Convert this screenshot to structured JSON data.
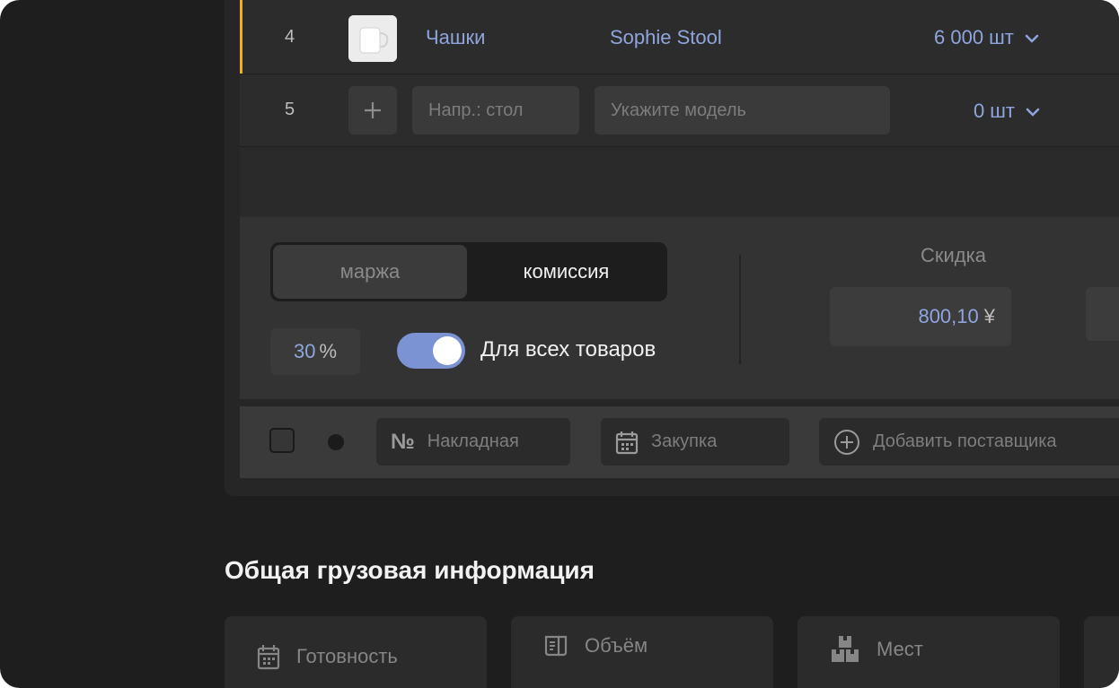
{
  "rows": [
    {
      "num": "4",
      "name": "Чашки",
      "model": "Sophie Stool",
      "qty": "6 000",
      "unit": "шт"
    },
    {
      "num": "5",
      "name_placeholder": "Напр.: стол",
      "model_placeholder": "Укажите модель",
      "qty": "0",
      "unit": "шт"
    }
  ],
  "pricing": {
    "mode_options": [
      "маржа",
      "комиссия"
    ],
    "selected_mode": "комиссия",
    "percent_value": "30",
    "percent_unit": "%",
    "toggle_label": "Для всех товаров",
    "toggle_on": true,
    "discount_label": "Скидка",
    "discount_value": "800,10",
    "discount_currency": "¥"
  },
  "supplier_bar": {
    "invoice_prefix": "№",
    "invoice_placeholder": "Накладная",
    "purchase_placeholder": "Закупка",
    "add_supplier_label": "Добавить поставщика"
  },
  "cargo": {
    "title": "Общая грузовая информация",
    "cards": [
      {
        "icon": "calendar-icon",
        "label": "Готовность"
      },
      {
        "icon": "volume-icon",
        "label": "Объём"
      },
      {
        "icon": "boxes-icon",
        "label": "Мест"
      }
    ]
  },
  "colors": {
    "accent": "#8ea6dd",
    "toggle": "#7b93d2",
    "row_marker": "#f2b01e",
    "background": "#1e1e1e"
  }
}
